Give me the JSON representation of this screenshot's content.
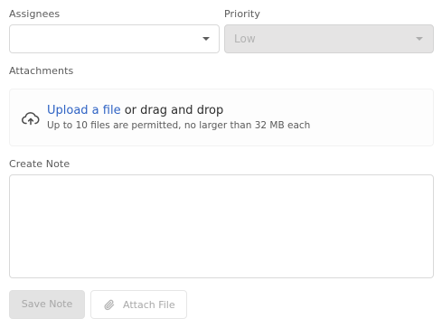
{
  "assignees": {
    "label": "Assignees",
    "value": ""
  },
  "priority": {
    "label": "Priority",
    "value": "Low"
  },
  "attachments": {
    "label": "Attachments",
    "upload_link": "Upload a file",
    "drag_text": " or drag and drop",
    "hint": "Up to 10 files are permitted, no larger than 32 MB each",
    "icon": "cloud-upload-icon"
  },
  "note": {
    "label": "Create Note",
    "value": ""
  },
  "actions": {
    "save_label": "Save Note",
    "attach_label": "Attach File",
    "attach_icon": "paperclip-icon"
  }
}
